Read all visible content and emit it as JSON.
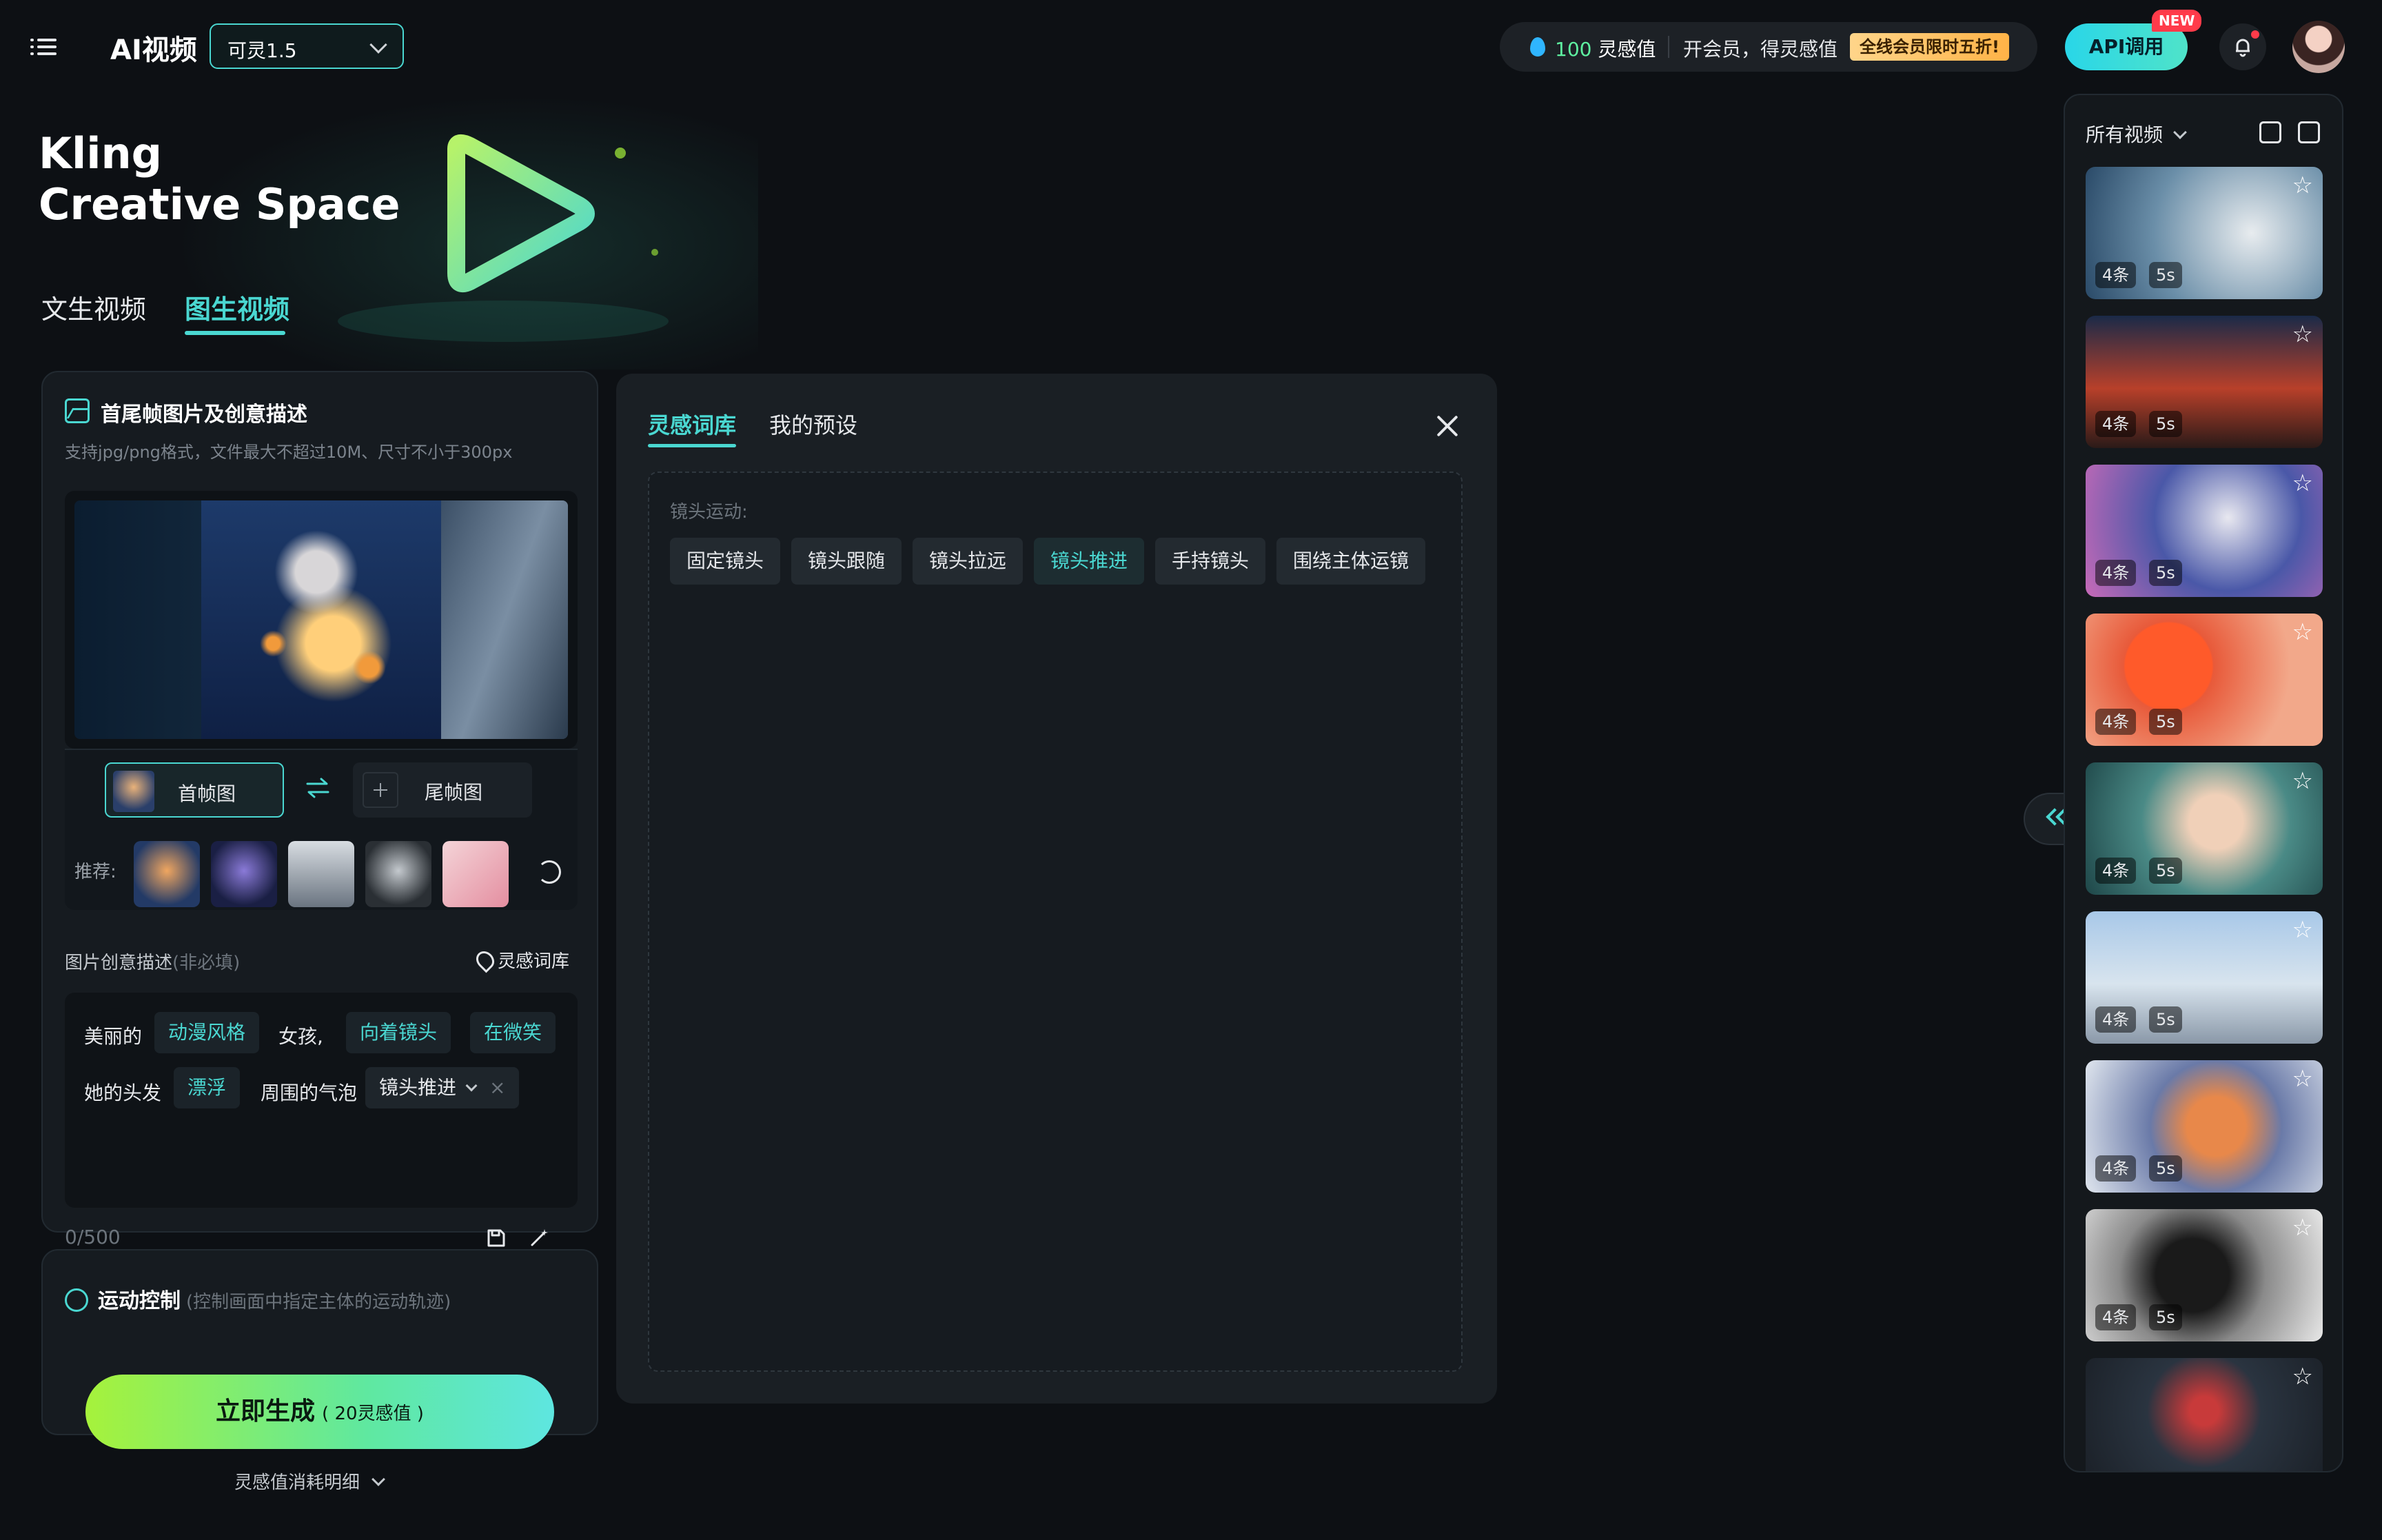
{
  "header": {
    "app_title": "AI视频",
    "model": "可灵1.5",
    "points_value": "100",
    "points_unit": "灵感值",
    "promo_text": "开会员，得灵感值",
    "sale_badge": "全线会员限时五折!",
    "api_button": "API调用",
    "new_badge": "NEW",
    "icons": [
      "menu-icon",
      "chevron-down-icon",
      "droplet-icon",
      "bell-icon"
    ]
  },
  "hero": {
    "line1": "Kling",
    "line2": "Creative Space",
    "tabs": [
      {
        "label": "文生视频",
        "active": false
      },
      {
        "label": "图生视频",
        "active": true
      }
    ]
  },
  "image_section": {
    "title": "首尾帧图片及创意描述",
    "subtitle": "支持jpg/png格式，文件最大不超过10M、尺寸不小于300px",
    "first_frame_label": "首帧图",
    "last_frame_label": "尾帧图",
    "recommend_label": "推荐:",
    "recommend_count": 5
  },
  "description": {
    "label": "图片创意描述",
    "optional": "(非必填)",
    "inspiration_link": "灵感词库",
    "line1": [
      {
        "text": "美丽的",
        "tag": false
      },
      {
        "text": "动漫风格",
        "tag": true
      },
      {
        "text": "女孩,",
        "tag": false
      },
      {
        "text": "向着镜头",
        "tag": true
      },
      {
        "text": "在微笑",
        "tag": true
      }
    ],
    "line2": [
      {
        "text": "她的头发",
        "tag": false
      },
      {
        "text": "漂浮",
        "tag": true
      },
      {
        "text": "周围的气泡",
        "tag": false
      }
    ],
    "dropdown_tag": "镜头推进",
    "char_count": "0/500"
  },
  "motion": {
    "title": "运动控制",
    "subtitle": "(控制画面中指定主体的运动轨迹)"
  },
  "generate": {
    "label": "立即生成",
    "cost": "( 20灵感值 )",
    "cost_detail": "灵感值消耗明细"
  },
  "inspiration_panel": {
    "tabs": [
      {
        "label": "灵感词库",
        "active": true
      },
      {
        "label": "我的预设",
        "active": false
      }
    ],
    "category_label": "镜头运动:",
    "chips": [
      {
        "label": "固定镜头",
        "active": false
      },
      {
        "label": "镜头跟随",
        "active": false
      },
      {
        "label": "镜头拉远",
        "active": false
      },
      {
        "label": "镜头推进",
        "active": true
      },
      {
        "label": "手持镜头",
        "active": false
      },
      {
        "label": "围绕主体运镜",
        "active": false
      }
    ]
  },
  "sidebar": {
    "title": "所有视频",
    "videos": [
      {
        "count": "4条",
        "duration": "5s"
      },
      {
        "count": "4条",
        "duration": "5s"
      },
      {
        "count": "4条",
        "duration": "5s"
      },
      {
        "count": "4条",
        "duration": "5s"
      },
      {
        "count": "4条",
        "duration": "5s"
      },
      {
        "count": "4条",
        "duration": "5s"
      },
      {
        "count": "4条",
        "duration": "5s"
      },
      {
        "count": "4条",
        "duration": "5s"
      },
      {
        "count": "",
        "duration": ""
      }
    ]
  },
  "colors": {
    "accent": "#4ad7d1",
    "background": "#0d1014",
    "generate_start": "#a6f23b",
    "generate_end": "#5ee6e0"
  }
}
